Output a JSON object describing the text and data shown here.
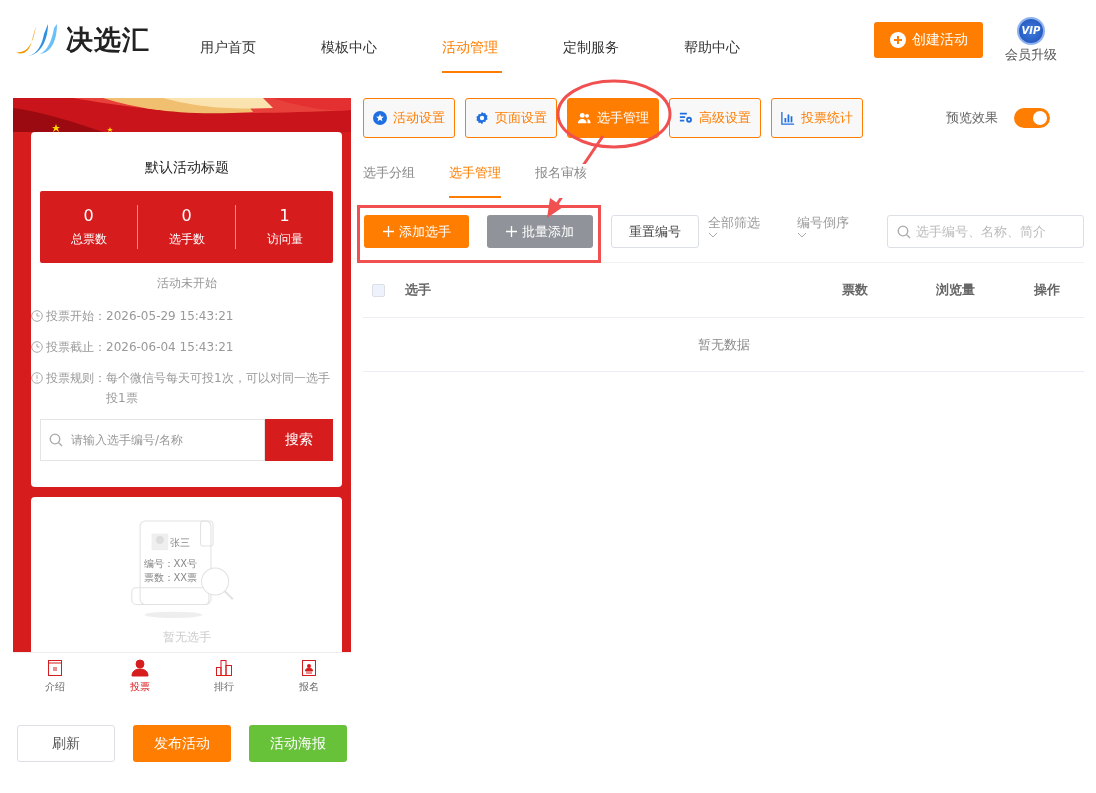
{
  "header": {
    "logo": "决选汇",
    "nav": [
      {
        "label": "用户首页",
        "selected": false
      },
      {
        "label": "模板中心",
        "selected": false
      },
      {
        "label": "活动管理",
        "selected": true
      },
      {
        "label": "定制服务",
        "selected": false
      },
      {
        "label": "帮助中心",
        "selected": false
      }
    ],
    "create_button": "创建活动",
    "vip_badge": "VIP",
    "vip_label": "会员升级"
  },
  "preview": {
    "title": "默认活动标题",
    "stats": [
      {
        "value": "0",
        "label": "总票数"
      },
      {
        "value": "0",
        "label": "选手数"
      },
      {
        "value": "1",
        "label": "访问量"
      }
    ],
    "status": "活动未开始",
    "info": [
      {
        "kind": "clock",
        "label": "投票开始：",
        "value": "2026-05-29 15:43:21"
      },
      {
        "kind": "clock",
        "label": "投票截止：",
        "value": "2026-06-04 15:43:21"
      },
      {
        "kind": "info",
        "label": "投票规则：",
        "value": "每个微信号每天可投1次，可以对同一选手投1票"
      }
    ],
    "search_placeholder": "请输入选手编号/名称",
    "search_button": "搜索",
    "illustration": {
      "name": "张三",
      "lines": [
        "编号：XX号",
        "票数：XX票"
      ]
    },
    "empty": "暂无选手",
    "bottom_nav": [
      {
        "kind": "intro",
        "label": "介绍",
        "selected": false
      },
      {
        "kind": "vote",
        "label": "投票",
        "selected": true
      },
      {
        "kind": "rank",
        "label": "排行",
        "selected": false
      },
      {
        "kind": "signup",
        "label": "报名",
        "selected": false
      }
    ]
  },
  "actions": [
    {
      "kind": "outline",
      "label": "刷新"
    },
    {
      "kind": "primary",
      "label": "发布活动"
    },
    {
      "kind": "success",
      "label": "活动海报"
    }
  ],
  "settings_tabs": [
    {
      "label": "活动设置",
      "selected": false
    },
    {
      "label": "页面设置",
      "selected": false
    },
    {
      "label": "选手管理",
      "selected": true
    },
    {
      "label": "高级设置",
      "selected": false
    },
    {
      "label": "投票统计",
      "selected": false
    }
  ],
  "preview_toggle": {
    "label": "预览效果",
    "on": true
  },
  "subtabs": [
    {
      "label": "选手分组",
      "selected": false
    },
    {
      "label": "选手管理",
      "selected": true
    },
    {
      "label": "报名审核",
      "selected": false
    }
  ],
  "toolbar": {
    "add_button": "添加选手",
    "batch_button": "批量添加",
    "reset_button": "重置编号",
    "filters": [
      "全部筛选",
      "编号倒序"
    ],
    "search_placeholder": "选手编号、名称、简介"
  },
  "table": {
    "select_all": {
      "checked": false
    },
    "columns": [
      "选手",
      "票数",
      "浏览量",
      "操作"
    ],
    "empty": "暂无数据"
  }
}
